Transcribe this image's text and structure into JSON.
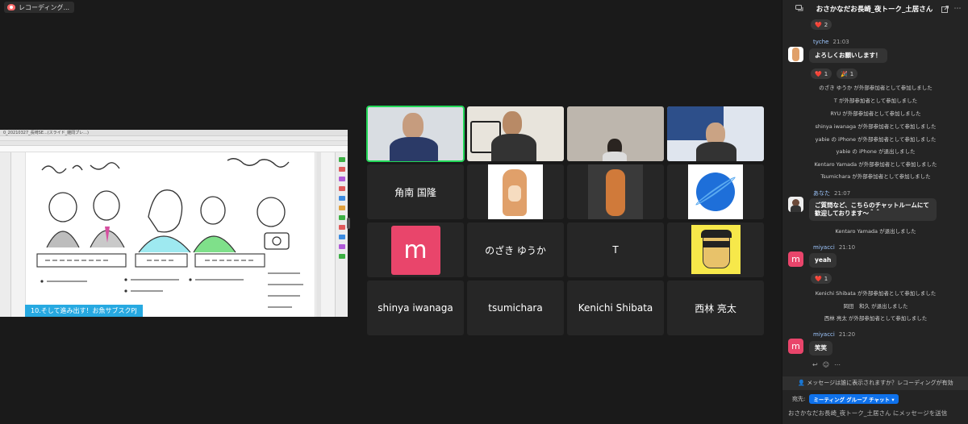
{
  "recording": {
    "label": "レコーディング..."
  },
  "share": {
    "caption": "10.そして進み出す！お魚サブスクPJ",
    "window_title": "0_20210327_長崎SE...(スライド_雑問プレ...)"
  },
  "grid": {
    "tiles": [
      {
        "name": "",
        "kind": "video"
      },
      {
        "name": "",
        "kind": "video"
      },
      {
        "name": "",
        "kind": "video"
      },
      {
        "name": "",
        "kind": "video"
      },
      {
        "name": "角南 国隆",
        "kind": "name"
      },
      {
        "name": "",
        "kind": "image-dog"
      },
      {
        "name": "",
        "kind": "image-figure"
      },
      {
        "name": "",
        "kind": "image-orb"
      },
      {
        "name": "m",
        "kind": "avatar"
      },
      {
        "name": "のざき ゆうか",
        "kind": "name"
      },
      {
        "name": "T",
        "kind": "name"
      },
      {
        "name": "",
        "kind": "image-face"
      },
      {
        "name": "shinya iwanaga",
        "kind": "name"
      },
      {
        "name": "tsumichara",
        "kind": "name"
      },
      {
        "name": "Kenichi Shibata",
        "kind": "name"
      },
      {
        "name": "西林 亮太",
        "kind": "name"
      }
    ]
  },
  "chat": {
    "title": "おさかなだお長崎_夜トーク_土居さん",
    "reaction_top": {
      "emoji": "❤️",
      "count": "2"
    },
    "msg1": {
      "sender": "tyche",
      "time": "21:03",
      "text": "よろしくお願いします！",
      "r1": "1",
      "r2": "1"
    },
    "sys1": [
      "のざき ゆうか が外部参加者として参加しました",
      "T が外部参加者として参加しました",
      "RYU が外部参加者として参加しました",
      "shinya iwanaga が外部参加者として参加しました",
      "yabie の iPhone が外部参加者として参加しました",
      "yabie の iPhone が退出しました",
      "Kentaro Yamada が外部参加者として参加しました",
      "Tsumichara が外部参加者として参加しました"
    ],
    "msg2": {
      "sender": "あなた",
      "time": "21:07",
      "line1": "ご質問など、こちらのチャットルームにて",
      "line2": "歓迎しております〜＾＾"
    },
    "sys2": "Kentaro Yamada が退出しました",
    "msg3": {
      "sender": "miyacci",
      "time": "21:10",
      "text": "yeah",
      "r1": "1"
    },
    "sys3": [
      "Kenichi Shibata が外部参加者として参加しました",
      "岡田　和久 が退出しました",
      "西林 亮太 が外部参加者として参加しました"
    ],
    "msg4": {
      "sender": "miyacci",
      "time": "21:20",
      "text": "笑笑"
    },
    "notice": "メッセージは誰に表示されますか？レコーディングが有効",
    "to_label": "宛先:",
    "to_target": "ミーティング グループ チャット",
    "input_placeholder": "おさかなだお長崎_夜トーク_土居さん にメッセージを送信"
  }
}
